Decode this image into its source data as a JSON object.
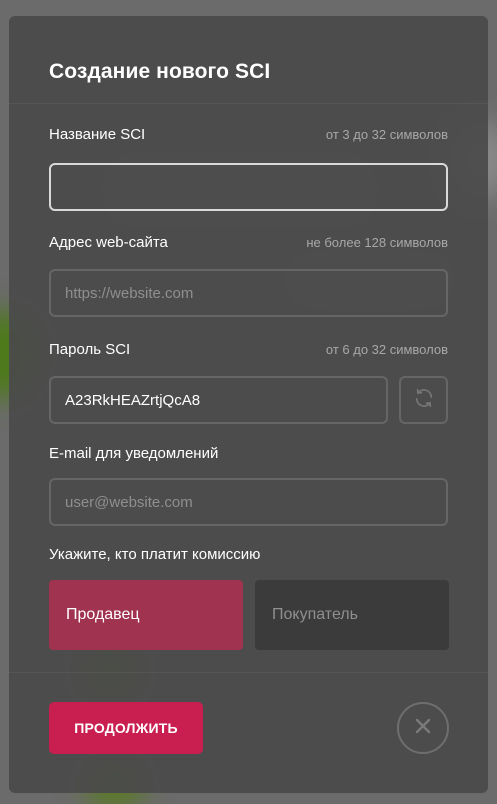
{
  "modal": {
    "title": "Создание нового SCI"
  },
  "fields": {
    "name": {
      "label": "Название SCI",
      "hint": "от 3 до 32 символов",
      "value": "",
      "placeholder": ""
    },
    "website": {
      "label": "Адрес web-сайта",
      "hint": "не более 128 символов",
      "value": "",
      "placeholder": "https://website.com"
    },
    "password": {
      "label": "Пароль SCI",
      "hint": "от 6 до 32 символов",
      "value": "A23RkHEAZrtjQcA8",
      "placeholder": "",
      "refresh_icon": "refresh-icon"
    },
    "email": {
      "label": "E-mail для уведомлений",
      "value": "",
      "placeholder": "user@website.com"
    }
  },
  "commission": {
    "label": "Укажите, кто платит комиссию",
    "options": [
      {
        "label": "Продавец",
        "selected": true
      },
      {
        "label": "Покупатель",
        "selected": false
      }
    ]
  },
  "footer": {
    "continue_label": "ПРОДОЛЖИТЬ",
    "close_icon": "close-icon"
  },
  "colors": {
    "accent": "#c91f50",
    "selected_option": "#a03350",
    "modal_bg": "#4a4a4a"
  }
}
